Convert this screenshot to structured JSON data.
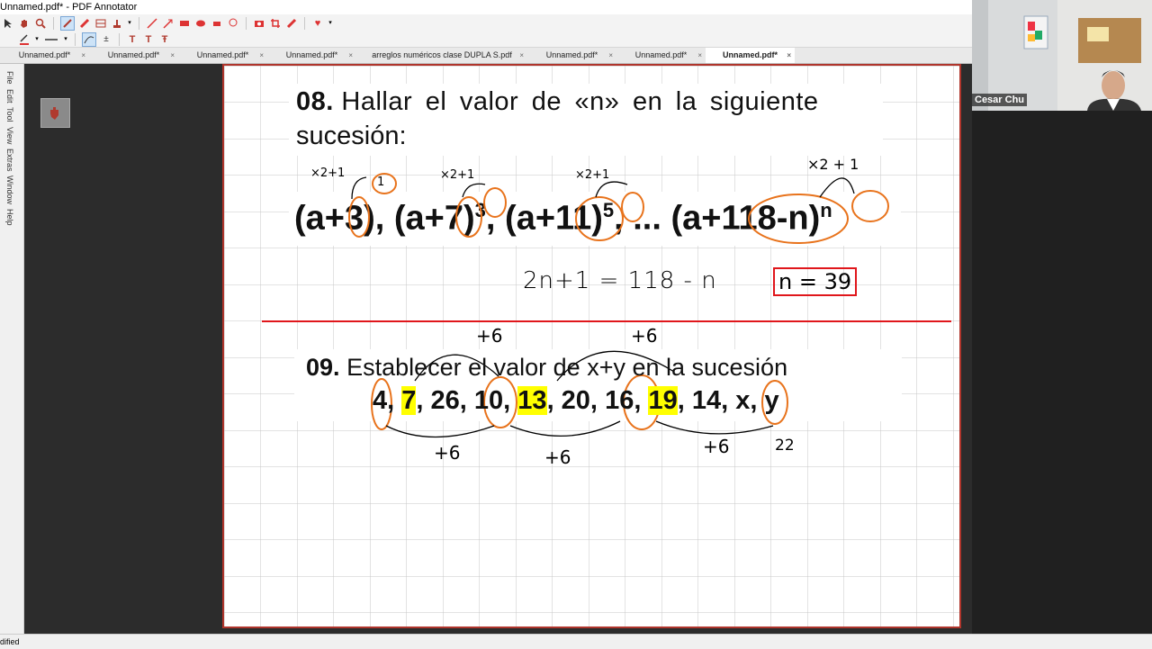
{
  "window": {
    "title": "Unnamed.pdf* - PDF Annotator"
  },
  "toolbar": {
    "row1_icons": [
      "cursor-icon",
      "hand-icon",
      "zoom-icon",
      "pen-icon",
      "highlighter-icon",
      "table-icon",
      "stamp-icon",
      "line-icon",
      "arrow-icon",
      "rectangle-icon",
      "ellipse-icon",
      "camera-icon",
      "shape-icon",
      "eraser-icon",
      "lasso-icon",
      "crop-icon",
      "ruler-icon",
      "heart-icon"
    ],
    "row2_icons": [
      "color-pen-icon",
      "line-style-icon",
      "smooth-icon",
      "text-underline-icon",
      "text-insert-icon",
      "text-strikethrough-icon"
    ]
  },
  "tabs": [
    {
      "label": "Unnamed.pdf*",
      "active": false
    },
    {
      "label": "Unnamed.pdf*",
      "active": false
    },
    {
      "label": "Unnamed.pdf*",
      "active": false
    },
    {
      "label": "Unnamed.pdf*",
      "active": false
    },
    {
      "label": "arreglos numéricos clase DUPLA S.pdf",
      "active": false
    },
    {
      "label": "Unnamed.pdf*",
      "active": false
    },
    {
      "label": "Unnamed.pdf*",
      "active": false
    },
    {
      "label": "Unnamed.pdf*",
      "active": true
    }
  ],
  "side_menu": [
    "File",
    "Edit",
    "Tool",
    "View",
    "Extras",
    "Window",
    "Help"
  ],
  "document": {
    "q08": {
      "number": "08.",
      "statement_line1": "Hallar el valor de «n» en la siguiente",
      "statement_line2": "sucesión:",
      "terms": [
        "(a+3),",
        "(a+7)",
        "3",
        ",",
        "(a+11)",
        "5",
        ", ...",
        "(a+118-n)",
        "n"
      ],
      "annotations": {
        "rule1": "×2+1",
        "rule2": "×2+1",
        "rule3": "×2+1",
        "rule4": "×2 + 1",
        "circle1": "1",
        "equation": "2n+1 = 118 - n",
        "answer": "n = 39"
      }
    },
    "q09": {
      "number": "09.",
      "statement": "Establecer el valor de x+y en la sucesión",
      "sequence": [
        {
          "text": "4",
          "hl": false
        },
        {
          "text": ", ",
          "hl": false
        },
        {
          "text": "7",
          "hl": true
        },
        {
          "text": ", 26, ",
          "hl": false
        },
        {
          "text": "10",
          "hl": false
        },
        {
          "text": ", ",
          "hl": false
        },
        {
          "text": "13",
          "hl": true
        },
        {
          "text": ", 20, ",
          "hl": false
        },
        {
          "text": "16",
          "hl": false
        },
        {
          "text": ", ",
          "hl": false
        },
        {
          "text": "19",
          "hl": true
        },
        {
          "text": ", 14, ",
          "hl": false
        },
        {
          "text": "x",
          "hl": false
        },
        {
          "text": ", y",
          "hl": false
        }
      ],
      "annotations": {
        "top1": "+6",
        "top2": "+6",
        "bottom1": "+6",
        "bottom2": "+6",
        "bottom3": "+6",
        "value22": "22"
      }
    }
  },
  "video": {
    "participant": "Cesar Chu"
  },
  "status": {
    "text": "dified"
  },
  "colors": {
    "ink_orange": "#e8731c",
    "answer_red": "#e0161b",
    "highlight": "#ffff00",
    "page_border": "#b0352c"
  }
}
